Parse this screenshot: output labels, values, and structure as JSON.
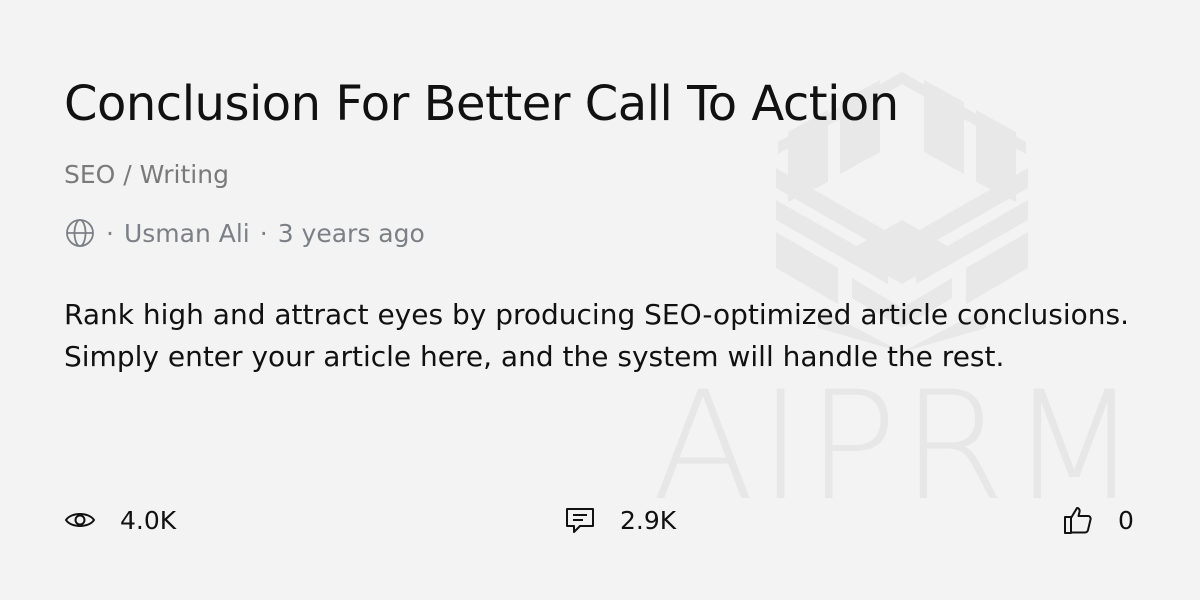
{
  "card": {
    "title": "Conclusion For Better Call To Action",
    "category": "SEO / Writing",
    "meta": {
      "separator": "·",
      "author": "Usman Ali",
      "time_ago": "3 years ago",
      "visibility_icon": "globe-icon"
    },
    "description": "Rank high and attract eyes by producing SEO-optimized article conclusions. Simply enter your article here, and the system will handle the rest.",
    "stats": {
      "views": {
        "icon": "eye-icon",
        "value": "4.0K"
      },
      "comments": {
        "icon": "comment-icon",
        "value": "2.9K"
      },
      "likes": {
        "icon": "thumbs-up-icon",
        "value": "0"
      }
    },
    "watermark": {
      "text": "AIPRM",
      "color": "#e7e7e7"
    }
  },
  "colors": {
    "background": "#f3f3f3",
    "text": "#111111",
    "muted": "#7c7f86"
  }
}
